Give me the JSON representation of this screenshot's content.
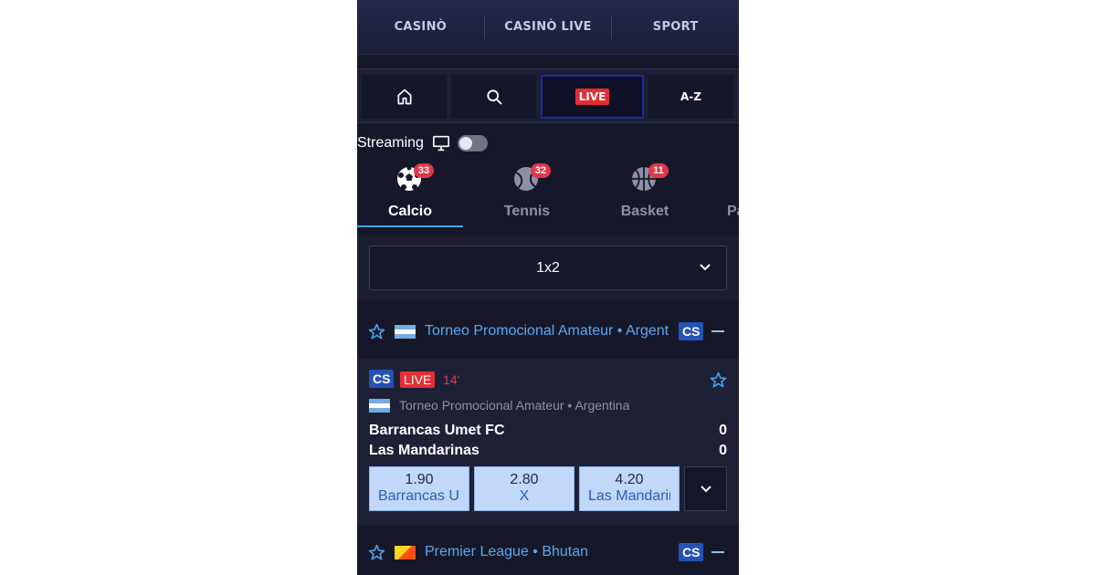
{
  "topnav": {
    "items": [
      "CASINÒ",
      "CASINÒ LIVE",
      "SPORT"
    ]
  },
  "iconbar": {
    "live_label": "LIVE",
    "az_label": "A-Z",
    "icons": [
      "home-icon",
      "search-icon",
      "live-badge",
      "az-icon"
    ]
  },
  "streaming": {
    "label": "Streaming",
    "enabled": false
  },
  "sports": [
    {
      "name": "Calcio",
      "count": "33",
      "active": true,
      "icon": "soccer-ball-icon"
    },
    {
      "name": "Tennis",
      "count": "32",
      "active": false,
      "icon": "tennis-ball-icon"
    },
    {
      "name": "Basket",
      "count": "11",
      "active": false,
      "icon": "basketball-icon"
    },
    {
      "name": "Pallavolo",
      "count": "",
      "active": false,
      "icon": "volleyball-icon"
    }
  ],
  "market": {
    "selected": "1x2"
  },
  "leagues": [
    {
      "name": "Torneo Promocional Amateur • Argentina",
      "badge": "CS"
    },
    {
      "name": "Premier League • Bhutan",
      "badge": "CS"
    }
  ],
  "event": {
    "badge": "CS",
    "live_label": "LIVE",
    "minute": "14'",
    "competition": "Torneo Promocional Amateur • Argentina",
    "home": {
      "name": "Barrancas Umet FC",
      "score": "0"
    },
    "away": {
      "name": "Las Mandarinas",
      "score": "0"
    },
    "odds": [
      {
        "value": "1.90",
        "label": "Barrancas Umet FC"
      },
      {
        "value": "2.80",
        "label": "X"
      },
      {
        "value": "4.20",
        "label": "Las Mandarinas"
      }
    ]
  },
  "colors": {
    "accent": "#36a9e8",
    "live": "#e42d35",
    "badge": "#2452b5",
    "odds_bg": "#c1d8fb"
  }
}
